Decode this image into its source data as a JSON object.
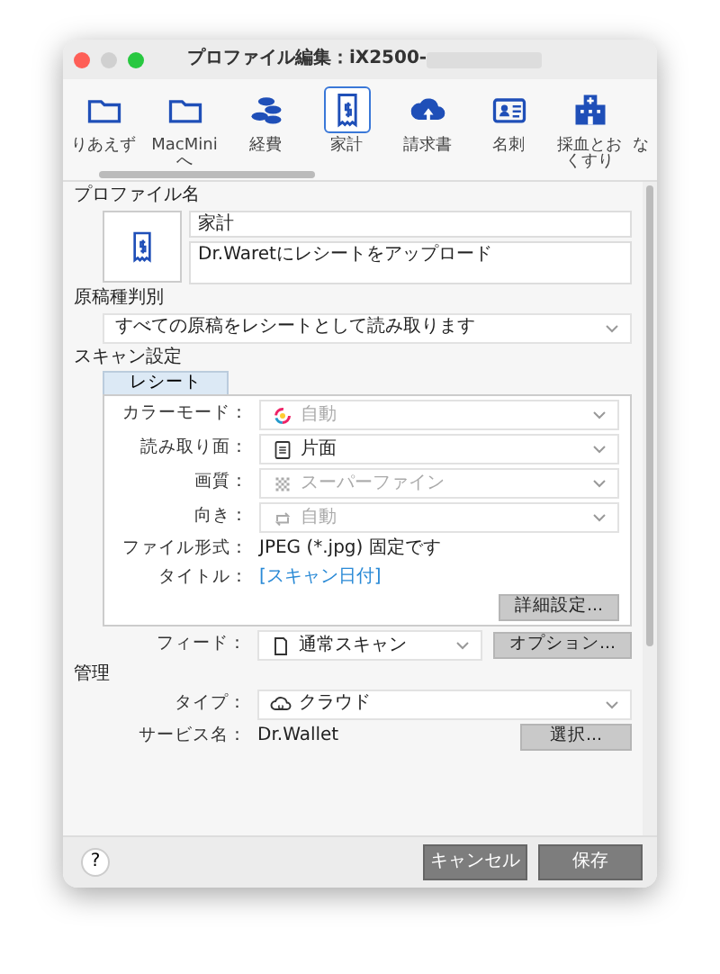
{
  "window": {
    "title": "プロファイル編集：iX2500-"
  },
  "toolbar": [
    {
      "label": "りあえず",
      "selected": false
    },
    {
      "label": "MacMiniへ",
      "selected": false
    },
    {
      "label": "経費",
      "selected": false
    },
    {
      "label": "家計",
      "selected": true
    },
    {
      "label": "請求書",
      "selected": false
    },
    {
      "label": "名刺",
      "selected": false
    },
    {
      "label": "採血とおくすり",
      "selected": false
    },
    {
      "label": "な",
      "selected": false
    }
  ],
  "profile": {
    "heading": "プロファイル名",
    "name": "家計",
    "description": "Dr.Waretにレシートをアップロード"
  },
  "doc_type": {
    "heading": "原稿種判別",
    "value": "すべての原稿をレシートとして読み取ります"
  },
  "scan": {
    "heading": "スキャン設定",
    "tab": {
      "label": "レシート",
      "selected": true
    },
    "rows": [
      {
        "label": "カラーモード：",
        "value": "自動",
        "disabled": true
      },
      {
        "label": "読み取り面：",
        "value": "片面",
        "disabled": false
      },
      {
        "label": "画質：",
        "value": "スーパーファイン",
        "disabled": true
      },
      {
        "label": "向き：",
        "value": "自動",
        "disabled": true
      }
    ],
    "file_format": {
      "label": "ファイル形式：",
      "value": "JPEG (*.jpg) 固定です"
    },
    "title": {
      "label": "タイトル：",
      "value": "[スキャン日付]"
    },
    "details_button": "詳細設定..."
  },
  "feed": {
    "label": "フィード：",
    "value": "通常スキャン",
    "button": "オプション..."
  },
  "management": {
    "heading": "管理",
    "type": {
      "label": "タイプ：",
      "value": "クラウド"
    },
    "service": {
      "label": "サービス名：",
      "value": "Dr.Wallet",
      "button": "選択..."
    }
  },
  "footer": {
    "help": "?",
    "buttons": [
      "キャンセル",
      "保存"
    ]
  }
}
